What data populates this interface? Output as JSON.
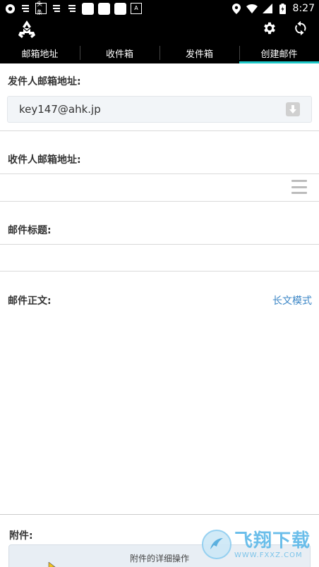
{
  "status_bar": {
    "time": "8:27",
    "left_icons": [
      "app-circle-icon",
      "notification-icon",
      "news-icon",
      "notification-icon",
      "notification-icon",
      "blank-square-icon",
      "blank-square-icon",
      "blank-square-icon",
      "font-icon"
    ],
    "news_badge": "头条",
    "font_badge": "A"
  },
  "app_bar": {
    "logo_icon": "recycle-mail-icon",
    "settings_icon": "gear-icon",
    "refresh_icon": "refresh-icon"
  },
  "tabs": [
    {
      "label": "邮箱地址",
      "active": false
    },
    {
      "label": "收件箱",
      "active": false
    },
    {
      "label": "发件箱",
      "active": false
    },
    {
      "label": "创建邮件",
      "active": true
    }
  ],
  "compose": {
    "from_label": "发件人邮箱地址:",
    "from_value": "key147@ahk.jp",
    "to_label": "收件人邮箱地址:",
    "to_value": "",
    "subject_label": "邮件标题:",
    "subject_value": "",
    "body_label": "邮件正文:",
    "long_text_mode": "长文模式",
    "body_value": "",
    "attachment_label": "附件:",
    "attachment_button": "附件的详细操作"
  },
  "watermark": {
    "title": "飞翔下载",
    "url": "WWW.FXXZ.COM"
  },
  "colors": {
    "active_tab_indicator": "#1ec8c8",
    "link": "#3b86c6",
    "bar_background": "#000000"
  }
}
